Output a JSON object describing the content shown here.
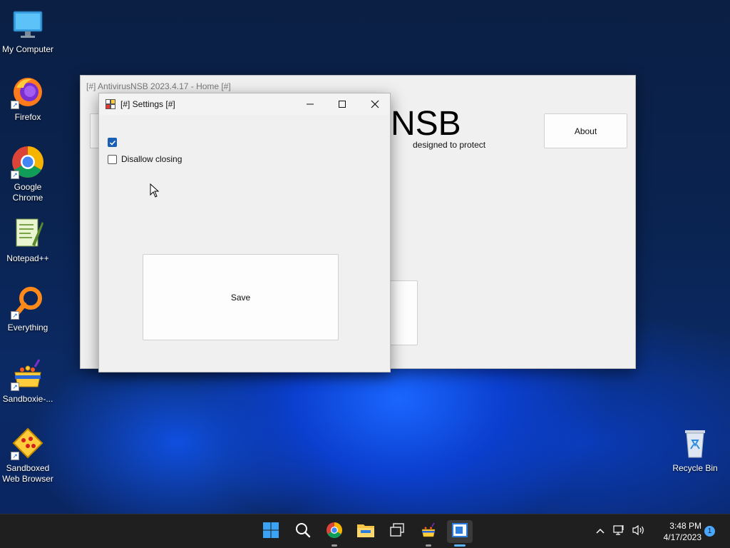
{
  "desktop": {
    "icons": [
      {
        "label": "My Computer"
      },
      {
        "label": "Firefox"
      },
      {
        "label": "Google Chrome"
      },
      {
        "label": "Notepad++"
      },
      {
        "label": "Everything"
      },
      {
        "label": "Sandboxie-..."
      },
      {
        "label": "Sandboxed Web Browser"
      },
      {
        "label": "Recycle Bin"
      }
    ]
  },
  "main_window": {
    "title": "[#] AntivirusNSB 2023.4.17 - Home [#]",
    "logo_text": "NSB",
    "subtitle": "designed to protect",
    "about_label": "About"
  },
  "settings_window": {
    "title": "[#] Settings [#]",
    "options": [
      {
        "checked": true
      },
      {
        "label": "Disallow closing",
        "checked": false
      }
    ],
    "save_label": "Save"
  },
  "taskbar": {
    "time": "3:48 PM",
    "date": "4/17/2023",
    "notification_count": "1"
  }
}
